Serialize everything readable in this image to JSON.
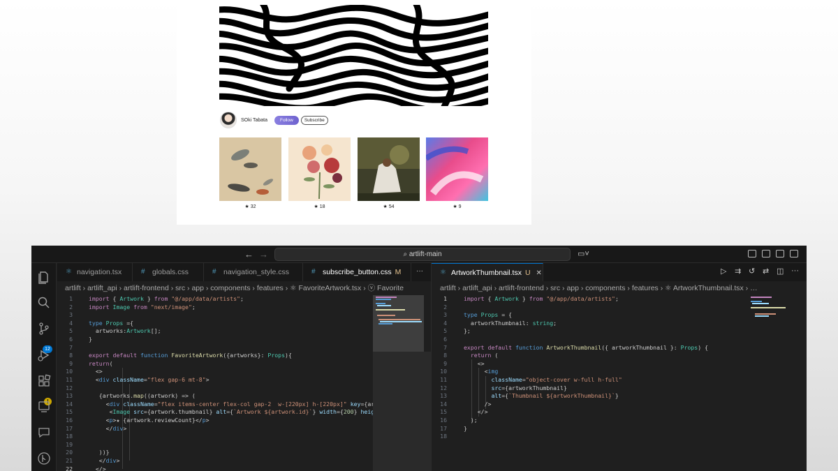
{
  "preview": {
    "artist_name": "SOki Tabata",
    "follow_label": "Follow",
    "subscribe_label": "Subscribe",
    "artworks": [
      {
        "count": "★ 32"
      },
      {
        "count": "★ 18"
      },
      {
        "count": "★ 54"
      },
      {
        "count": "★ 9"
      }
    ]
  },
  "ide": {
    "search_label": "artlift-main",
    "nav_back": "←",
    "nav_forward": "→",
    "badge_source_control": "12",
    "left_tabs": [
      {
        "label": "navigation.tsx",
        "icon": "⚛"
      },
      {
        "label": "globals.css",
        "icon": "#"
      },
      {
        "label": "navigation_style.css",
        "icon": "#"
      },
      {
        "label": "subscribe_button.css",
        "icon": "#",
        "mod": "M"
      }
    ],
    "tab_more": "···",
    "right_tab": {
      "label": "ArtworkThumbnail.tsx",
      "mod": "U",
      "close": "✕"
    },
    "left_breadcrumb": "artlift  ›  artlift_api  ›  artlift-frontend  ›  src  ›  app  ›  components  ›  features  ›  ⚛ FavoriteArtwork.tsx  ›  ⓥ Favorite",
    "right_breadcrumb": "artlift  ›  artlift_api  ›  artlift-frontend  ›  src  ›  app  ›  components  ›  features  ›  ⚛ ArtworkThumbnail.tsx  ›  …",
    "left_line_numbers": [
      "1",
      "2",
      "3",
      "4",
      "5",
      "6",
      "7",
      "8",
      "9",
      "10",
      "11",
      "12",
      "13",
      "14",
      "15",
      "16",
      "17",
      "18",
      "19",
      "20",
      "21",
      "22"
    ],
    "right_line_numbers": [
      "1",
      "2",
      "3",
      "4",
      "5",
      "6",
      "7",
      "8",
      "9",
      "10",
      "11",
      "12",
      "13",
      "14",
      "15",
      "16",
      "17",
      "18"
    ],
    "left_lines": [
      "import { Artwork } from \"@/app/data/artists\";",
      "import Image from \"next/image\";",
      "",
      "type Props ={",
      "  artworks:Artwork[];",
      "}",
      "",
      "export default function FavoriteArtwork({artworks}: Props){",
      "return(",
      "  <>",
      "  <div className=\"flex gap-6 mt-8\">",
      "",
      "   {artworks.map((artwork) => (",
      "     <div className=\"flex items-center flex-col gap-2  w-[220px] h-[220px]\" key={artwork",
      "      <Image src={artwork.thumbnail} alt={`Artwork ${artwork.id}`} width={200} height=",
      "     <p>★ {artwork.reviewCount}</p>",
      "     </div>",
      "",
      "",
      "   ))}",
      "   </div>",
      "  </>"
    ],
    "right_lines": [
      "import { Artwork } from \"@/app/data/artists\";",
      "",
      "type Props = {",
      "  artworkThumbnail: string;",
      "};",
      "",
      "export default function ArtworkThumbnail({ artworkThumbnail }: Props) {",
      "  return (",
      "    <>",
      "      <img",
      "        className=\"object-cover w-full h-full\"",
      "        src={artworkThumbnail}",
      "        alt={`Thumbnail ${artworkThumbnail}`}",
      "      />",
      "    </>",
      "  );",
      "}",
      ""
    ]
  }
}
